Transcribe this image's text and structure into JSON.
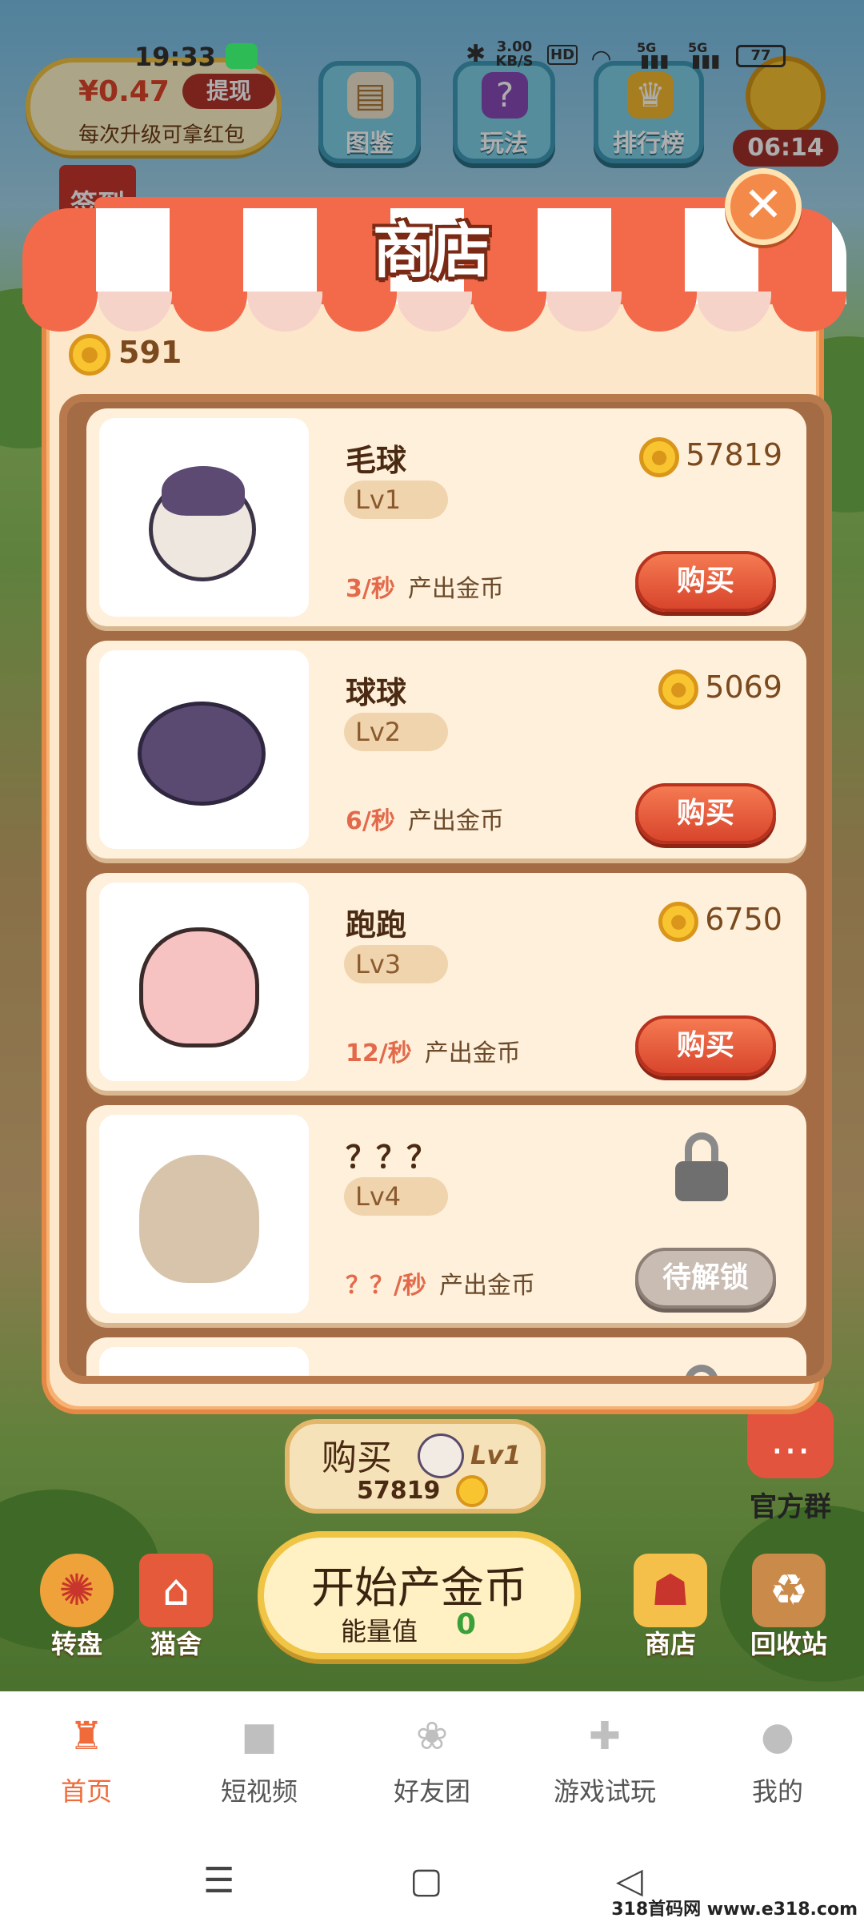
{
  "status_bar": {
    "time": "19:33",
    "net_speed": "3.00\nKB/S",
    "hd": "HD",
    "sig1": "5G",
    "sig2": "5G",
    "battery": "77"
  },
  "hud": {
    "money": "¥0.47",
    "withdraw": "提现",
    "money_tip": "每次升级可拿红包",
    "buttons": [
      {
        "label": "图鉴"
      },
      {
        "label": "玩法"
      },
      {
        "label": "排行榜"
      }
    ],
    "timer": "06:14",
    "signin": "签到"
  },
  "shop": {
    "title": "商店",
    "coins": "591",
    "items": [
      {
        "name": "毛球",
        "level": "Lv1",
        "price": "57819",
        "rate": "3/秒",
        "rate_text": "产出金币",
        "action": "购买"
      },
      {
        "name": "球球",
        "level": "Lv2",
        "price": "5069",
        "rate": "6/秒",
        "rate_text": "产出金币",
        "action": "购买"
      },
      {
        "name": "跑跑",
        "level": "Lv3",
        "price": "6750",
        "rate": "12/秒",
        "rate_text": "产出金币",
        "action": "购买"
      },
      {
        "name": "？？？",
        "level": "Lv4",
        "rate": "？？/秒",
        "rate_text": "产出金币",
        "action": "待解锁"
      },
      {
        "name": "？？？"
      }
    ]
  },
  "game_controls": {
    "buy_label": "购买",
    "buy_level": "Lv1",
    "buy_price": "57819",
    "start_label": "开始产金币",
    "energy_label": "能量值",
    "energy_value": "0",
    "official_group": "官方群",
    "wheel": "转盘",
    "cattery": "猫舍",
    "shop": "商店",
    "recycle": "回收站"
  },
  "nav": {
    "tabs": [
      {
        "label": "首页",
        "icon": "castle-icon"
      },
      {
        "label": "短视频",
        "icon": "video-icon"
      },
      {
        "label": "好友团",
        "icon": "paw-icon"
      },
      {
        "label": "游戏试玩",
        "icon": "gamepad-icon"
      },
      {
        "label": "我的",
        "icon": "profile-icon"
      }
    ]
  },
  "watermark": "318首码网 www.e318.com",
  "colors": {
    "accent": "#f06a3a",
    "buy": "#e2543a",
    "coin": "#f8c531"
  }
}
